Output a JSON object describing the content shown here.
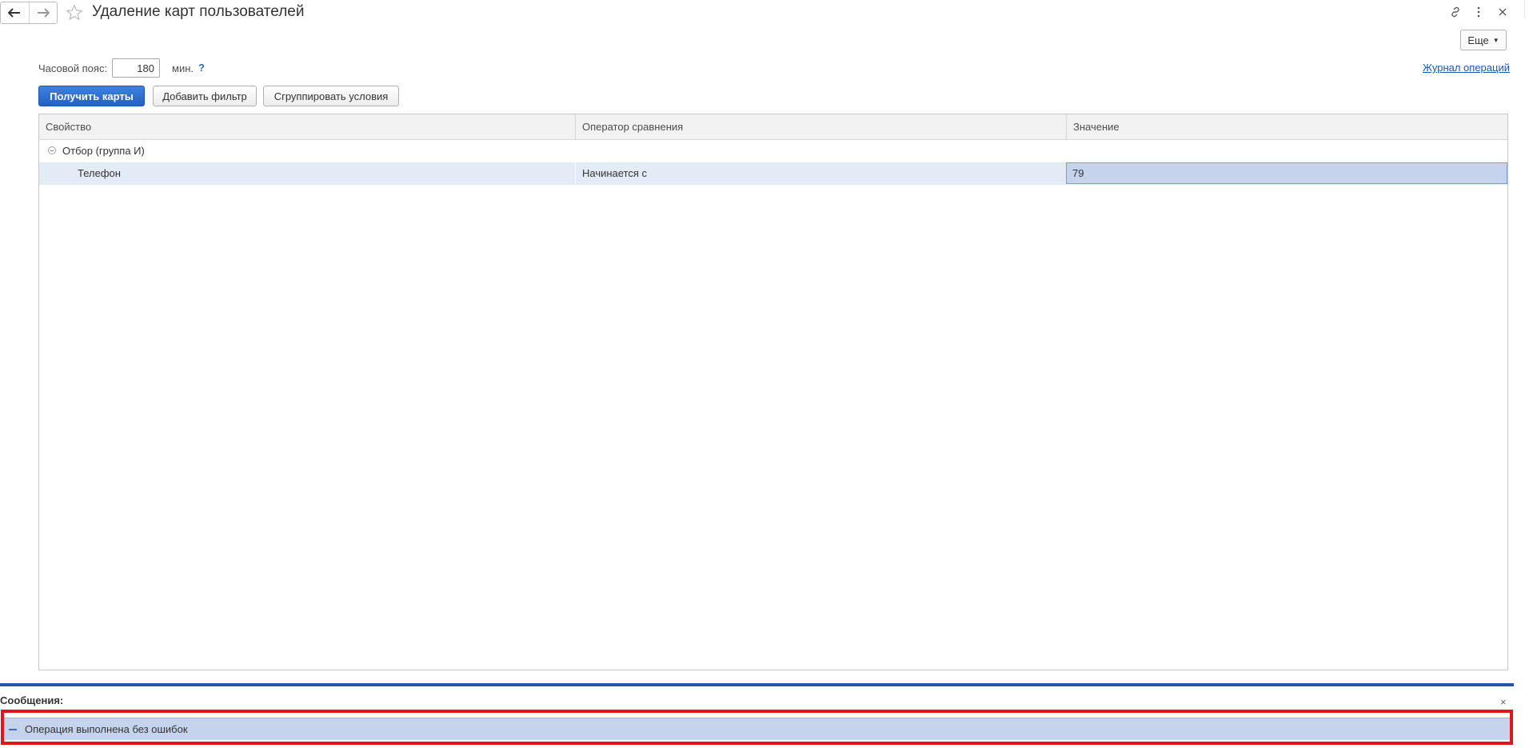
{
  "window": {
    "title": "Удаление карт пользователей"
  },
  "toolbar": {
    "more_label": "Еще"
  },
  "timezone": {
    "label": "Часовой пояс:",
    "value": "180",
    "unit": "мин.",
    "help": "?"
  },
  "links": {
    "operation_log": "Журнал операций"
  },
  "buttons": {
    "get_cards": "Получить карты",
    "add_filter": "Добавить фильтр",
    "group_conditions": "Сгруппировать условия"
  },
  "filter_table": {
    "columns": [
      "Свойство",
      "Оператор сравнения",
      "Значение"
    ],
    "group_row": {
      "label": "Отбор (группа И)"
    },
    "rows": [
      {
        "property": "Телефон",
        "operator": "Начинается с",
        "value": "79"
      }
    ]
  },
  "messages": {
    "title": "Сообщения:",
    "items": [
      {
        "text": "Операция выполнена без ошибок"
      }
    ]
  },
  "icons": {
    "back": "arrow-left-icon",
    "forward": "arrow-right-icon",
    "favorite": "star-icon",
    "link": "link-icon",
    "menu": "vertical-dots-icon",
    "close": "close-icon"
  },
  "colors": {
    "primary_button": "#2a6ad0",
    "selection": "#c5d4ec",
    "message_bar": "#2656a6",
    "highlight_border": "#e3141b",
    "link": "#1a58b6"
  }
}
